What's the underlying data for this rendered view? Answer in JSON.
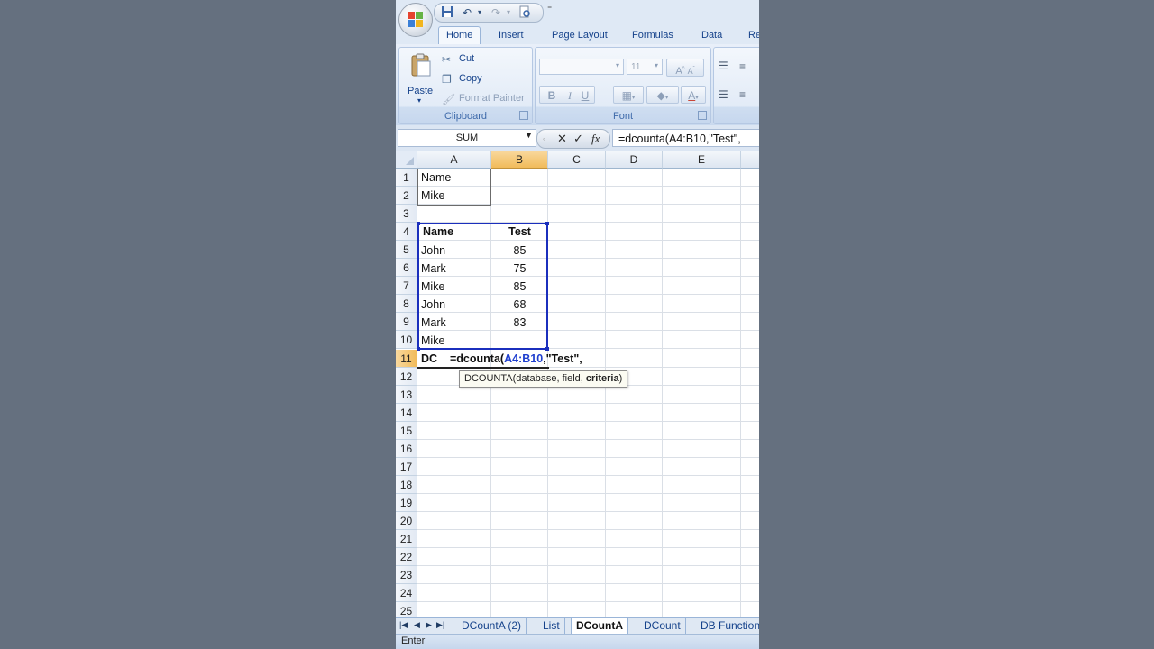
{
  "qat": {
    "icons": [
      "save-icon",
      "undo-icon",
      "redo-icon",
      "print-preview-icon"
    ],
    "more": "⁼"
  },
  "tabs": [
    {
      "label": "Home",
      "active": true
    },
    {
      "label": "Insert"
    },
    {
      "label": "Page Layout"
    },
    {
      "label": "Formulas"
    },
    {
      "label": "Data"
    },
    {
      "label": "Re"
    }
  ],
  "ribbon": {
    "clipboard": {
      "label": "Clipboard",
      "paste": "Paste",
      "cut": "Cut",
      "copy": "Copy",
      "format_painter": "Format Painter"
    },
    "font": {
      "label": "Font",
      "font_name": "",
      "font_size": "11",
      "bold": "B",
      "italic": "I",
      "underline": "U"
    }
  },
  "formula_bar": {
    "name_box": "SUM",
    "formula_plain": "=dcounta(A4:B10,\"Test\",",
    "formula_prefix": "=dcounta(",
    "formula_ref": "A4:B10",
    "formula_suffix": ",\"Test\","
  },
  "columns": [
    "A",
    "B",
    "C",
    "D",
    "E"
  ],
  "rows": [
    "1",
    "2",
    "3",
    "4",
    "5",
    "6",
    "7",
    "8",
    "9",
    "10",
    "11",
    "12",
    "13",
    "14",
    "15",
    "16",
    "17",
    "18",
    "19",
    "20",
    "21",
    "22",
    "23",
    "24",
    "25"
  ],
  "cells": {
    "a1": "Name",
    "a2": "Mike",
    "a4": "Name",
    "b4": "Test",
    "a5": "John",
    "b5": "85",
    "a6": "Mark",
    "b6": "75",
    "a7": "Mike",
    "b7": "85",
    "a8": "John",
    "b8": "68",
    "a9": "Mark",
    "b9": "83",
    "a10": "Mike",
    "a11": "DC"
  },
  "tooltip": {
    "prefix": "DCOUNTA(database, field, ",
    "bold_arg": "criteria",
    "suffix": ")"
  },
  "sheet_tabs": [
    {
      "label": "DCountA (2)"
    },
    {
      "label": "List"
    },
    {
      "label": "DCountA",
      "active": true
    },
    {
      "label": "DCount"
    },
    {
      "label": "DB Function"
    }
  ],
  "status": "Enter",
  "colors": {
    "ref_highlight": "#1f3fcf",
    "selection_header": "#f1bb5a"
  }
}
